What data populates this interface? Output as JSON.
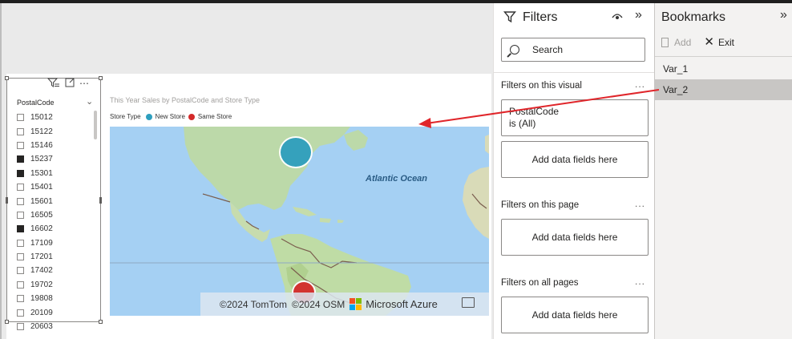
{
  "slicer": {
    "header": "PostalCode",
    "items": [
      {
        "label": "15012",
        "checked": false
      },
      {
        "label": "15122",
        "checked": false
      },
      {
        "label": "15146",
        "checked": false
      },
      {
        "label": "15237",
        "checked": true
      },
      {
        "label": "15301",
        "checked": true
      },
      {
        "label": "15401",
        "checked": false
      },
      {
        "label": "15601",
        "checked": false
      },
      {
        "label": "16505",
        "checked": false
      },
      {
        "label": "16602",
        "checked": true
      },
      {
        "label": "17109",
        "checked": false
      },
      {
        "label": "17201",
        "checked": false
      },
      {
        "label": "17402",
        "checked": false
      },
      {
        "label": "19702",
        "checked": false
      },
      {
        "label": "19808",
        "checked": false
      },
      {
        "label": "20109",
        "checked": false
      },
      {
        "label": "20603",
        "checked": false
      }
    ]
  },
  "map_visual": {
    "title": "This Year Sales by PostalCode and Store Type",
    "legend_title": "Store Type",
    "legend": [
      {
        "name": "New Store",
        "color": "#2e9fbe"
      },
      {
        "name": "Same Store",
        "color": "#d42a2a"
      }
    ],
    "ocean_label": "Atlantic Ocean",
    "attribution_tomtom": "©2024 TomTom",
    "attribution_osm": "©2024 OSM",
    "attribution_ms": "Microsoft Azure"
  },
  "filters": {
    "title": "Filters",
    "search_placeholder": "Search",
    "sections": {
      "visual": "Filters on this visual",
      "page": "Filters on this page",
      "all": "Filters on all pages"
    },
    "postal_card": {
      "field": "PostalCode",
      "state": "is (All)"
    },
    "add_fields": "Add data fields here",
    "more": "..."
  },
  "bookmarks": {
    "title": "Bookmarks",
    "add_label": "Add",
    "exit_label": "Exit",
    "items": [
      "Var_1",
      "Var_2"
    ],
    "selected": "Var_2"
  }
}
